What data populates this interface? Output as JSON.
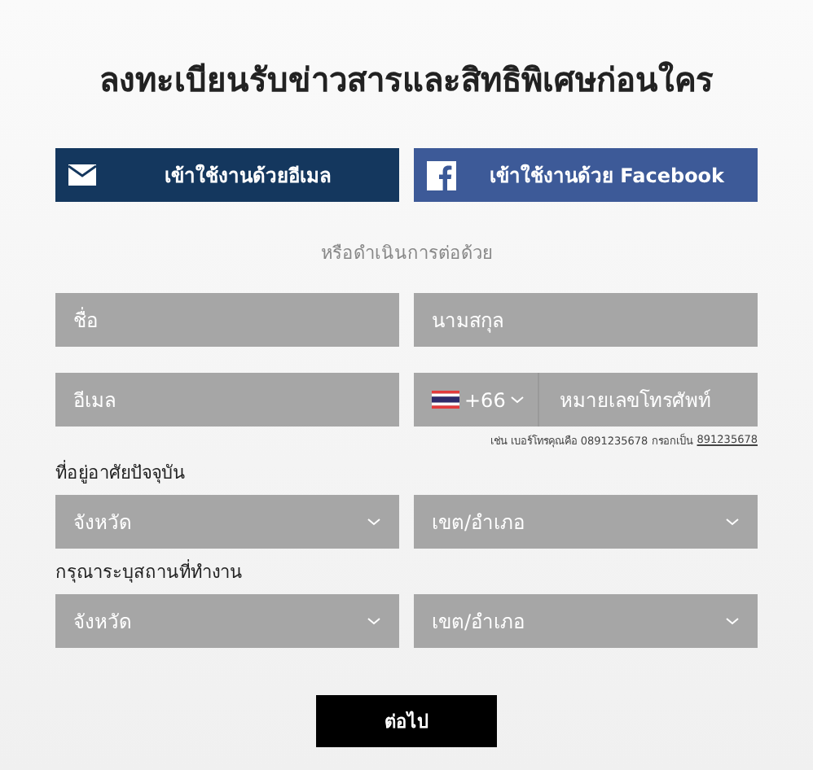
{
  "title": "ลงทะเบียนรับข่าวสารและสิทธิพิเศษก่อนใคร",
  "login_buttons": [
    {
      "kind": "email",
      "label": "เข้าใช้งานด้วยอีเมล"
    },
    {
      "kind": "facebook",
      "label": "เข้าใช้งานด้วย Facebook"
    }
  ],
  "divider_text": "หรือดำเนินการต่อด้วย",
  "first_name": {
    "placeholder": "ชื่อ"
  },
  "last_name": {
    "placeholder": "นามสกุล"
  },
  "email": {
    "placeholder": "อีเมล"
  },
  "phone": {
    "country_code": "+66",
    "placeholder": "หมายเลขโทรศัพท์"
  },
  "phone_hint": {
    "text": "เช่น เบอร์โทรคุณคือ 0891235678 กรอกเป็น",
    "example": "891235678"
  },
  "sections": [
    {
      "label": "ที่อยู่อาศัยปัจจุบัน",
      "selects": [
        "จังหวัด",
        "เขต/อำเภอ"
      ]
    },
    {
      "label": "กรุณาระบุสถานที่ทำงาน",
      "selects": [
        "จังหวัด",
        "เขต/อำเภอ"
      ]
    }
  ],
  "next_button": "ต่อไป"
}
